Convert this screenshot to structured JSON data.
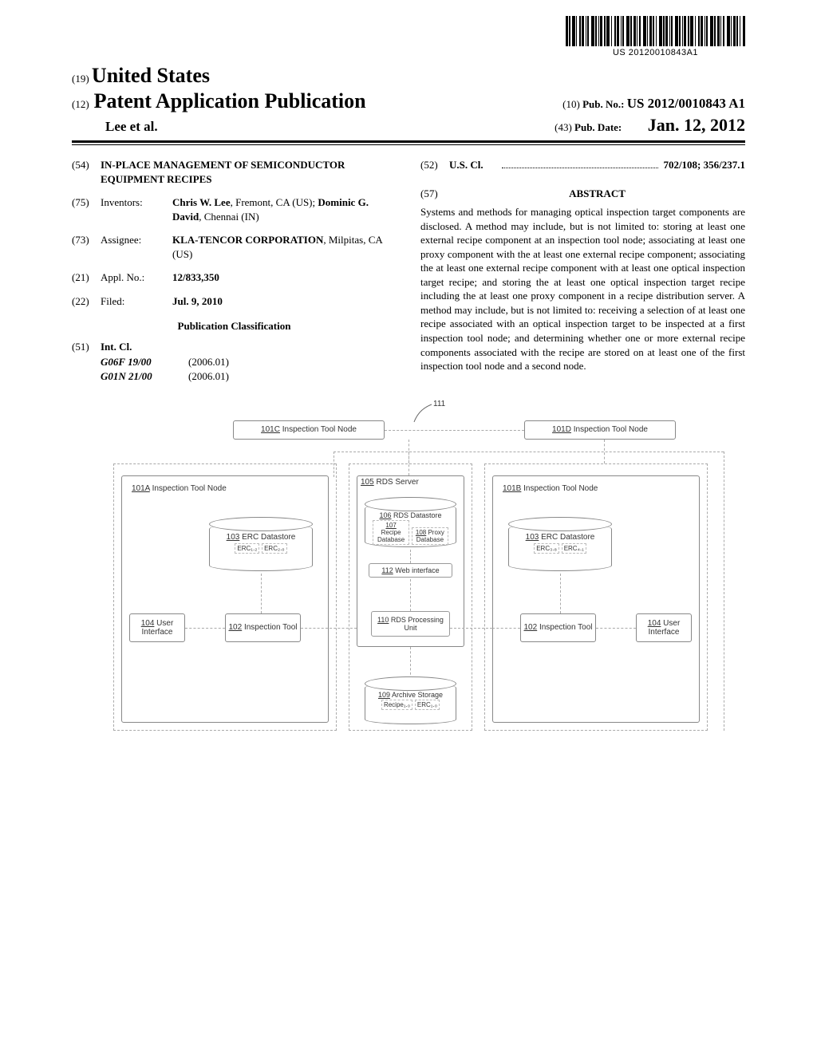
{
  "barcode_label": "US 20120010843A1",
  "header": {
    "country_code": "(19)",
    "country": "United States",
    "doc_code": "(12)",
    "pub_title": "Patent Application Publication",
    "author_line": "Lee et al.",
    "pubno_code": "(10)",
    "pubno_label": "Pub. No.:",
    "pubno_value": "US 2012/0010843 A1",
    "pubdate_code": "(43)",
    "pubdate_label": "Pub. Date:",
    "pubdate_value": "Jan. 12, 2012"
  },
  "fields": {
    "title_code": "(54)",
    "title": "IN-PLACE MANAGEMENT OF SEMICONDUCTOR EQUIPMENT RECIPES",
    "inventors_code": "(75)",
    "inventors_label": "Inventors:",
    "inventors_value_1": "Chris W. Lee",
    "inventors_value_1_loc": ", Fremont, CA (US);",
    "inventors_value_2": "Dominic G. David",
    "inventors_value_2_loc": ", Chennai (IN)",
    "assignee_code": "(73)",
    "assignee_label": "Assignee:",
    "assignee_value_1": "KLA-TENCOR CORPORATION",
    "assignee_value_1_loc": ", Milpitas, CA (US)",
    "appl_code": "(21)",
    "appl_label": "Appl. No.:",
    "appl_value": "12/833,350",
    "filed_code": "(22)",
    "filed_label": "Filed:",
    "filed_value": "Jul. 9, 2010",
    "pubclass_head": "Publication Classification",
    "intcl_code": "(51)",
    "intcl_label": "Int. Cl.",
    "intcl_1_sym": "G06F 19/00",
    "intcl_1_ver": "(2006.01)",
    "intcl_2_sym": "G01N 21/00",
    "intcl_2_ver": "(2006.01)",
    "uscl_code": "(52)",
    "uscl_label": "U.S. Cl.",
    "uscl_value": "702/108; 356/237.1",
    "abstract_code": "(57)",
    "abstract_head": "ABSTRACT",
    "abstract_body": "Systems and methods for managing optical inspection target components are disclosed. A method may include, but is not limited to: storing at least one external recipe component at an inspection tool node; associating at least one proxy component with the at least one external recipe component; associating the at least one external recipe component with at least one optical inspection target recipe; and storing the at least one optical inspection target recipe including the at least one proxy component in a recipe distribution server. A method may include, but is not limited to: receiving a selection of at least one recipe associated with an optical inspection target to be inspected at a first inspection tool node; and determining whether one or more external recipe components associated with the recipe are stored on at least one of the first inspection tool node and a second node."
  },
  "diagram": {
    "ref111": "111",
    "node_101c_ref": "101C",
    "node_101c_label": " Inspection Tool Node",
    "node_101d_ref": "101D",
    "node_101d_label": " Inspection Tool Node",
    "node_101a_ref": "101A",
    "node_101a_label": " Inspection Tool Node",
    "node_101b_ref": "101B",
    "node_101b_label": " Inspection Tool Node",
    "rds_server_ref": "105",
    "rds_server_label": " RDS Server",
    "ds103_ref": "103",
    "ds103_label": " ERC Datastore",
    "erc12": "ERC₁.₂",
    "erc20": "ERC₂.₀",
    "erc38": "ERC₃.₈",
    "erc41": "ERC₄.₁",
    "ui104_ref": "104",
    "ui104_label": " User Interface",
    "tool102_ref": "102",
    "tool102_label": " Inspection Tool",
    "ds106_ref": "106",
    "ds106_label": " RDS Datastore",
    "db107_ref": "107",
    "db107_label": " Recipe Database",
    "db108_ref": "108",
    "db108_label": " Proxy Database",
    "web112_ref": "112",
    "web112_label": " Web interface",
    "pu110_ref": "110",
    "pu110_label": " RDS Processing Unit",
    "arch109_ref": "109",
    "arch109_label": " Archive Storage",
    "recipe10": "Recipe₁.₀",
    "erc10": "ERC₁.₀"
  }
}
